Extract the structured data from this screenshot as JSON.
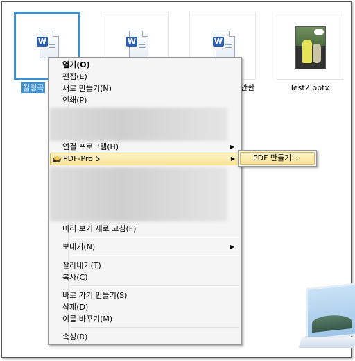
{
  "files": [
    {
      "label": "킬링곡",
      "selected": true,
      "type": "word"
    },
    {
      "label": "",
      "selected": false,
      "type": "word"
    },
    {
      "label": "안한",
      "selected": false,
      "type": "word"
    },
    {
      "label": "Test2.pptx",
      "selected": false,
      "type": "pptx"
    }
  ],
  "menu": {
    "open": "열기(O)",
    "edit": "편집(E)",
    "new": "새로 만들기(N)",
    "print": "인쇄(P)",
    "open_with": "연결 프로그램(H)",
    "pdfpro": "PDF-Pro 5",
    "refresh_preview": "미리 보기 새로 고침(F)",
    "send_to": "보내기(N)",
    "cut": "잘라내기(T)",
    "copy": "복사(C)",
    "shortcut": "바로 가기 만들기(S)",
    "delete": "삭제(D)",
    "rename": "이름 바꾸기(M)",
    "properties": "속성(R)"
  },
  "submenu": {
    "create_pdf": "PDF 만들기..."
  },
  "colors": {
    "selection": "#3d8fd0",
    "highlight": "#f9e49a"
  },
  "icons": [
    "word-document-icon",
    "presentation-thumbnail",
    "pdf-pro-icon",
    "submenu-arrow-icon",
    "laptop-icon"
  ]
}
